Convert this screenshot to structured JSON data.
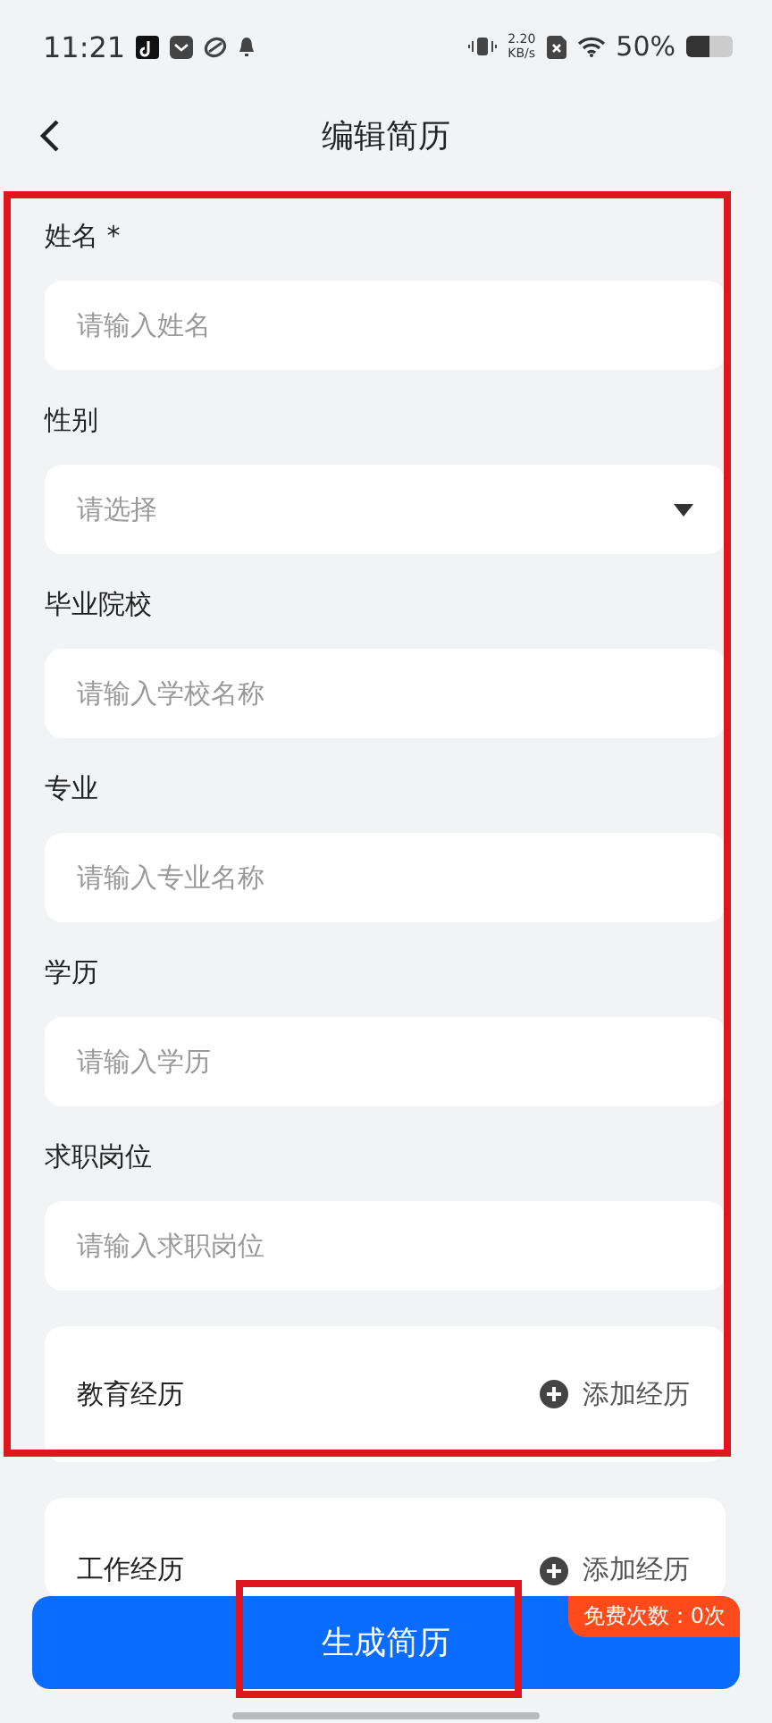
{
  "status_bar": {
    "time": "11:21",
    "net_speed": "2.20",
    "net_unit": "KB/s",
    "battery": "50%"
  },
  "header": {
    "title": "编辑简历"
  },
  "form_highlighted": true,
  "fields": [
    {
      "label": "姓名 *",
      "kind": "text",
      "placeholder": "请输入姓名"
    },
    {
      "label": "性别",
      "kind": "select",
      "placeholder": "请选择"
    },
    {
      "label": "毕业院校",
      "kind": "text",
      "placeholder": "请输入学校名称"
    },
    {
      "label": "专业",
      "kind": "text",
      "placeholder": "请输入专业名称"
    },
    {
      "label": "学历",
      "kind": "text",
      "placeholder": "请输入学历"
    },
    {
      "label": "求职岗位",
      "kind": "text",
      "placeholder": "请输入求职岗位"
    }
  ],
  "sections": [
    {
      "title": "教育经历",
      "action": "添加经历"
    },
    {
      "title": "工作经历",
      "action": "添加经历"
    }
  ],
  "generate_button": {
    "label": "生成简历",
    "badge": "免费次数：0次",
    "highlighted": true
  }
}
